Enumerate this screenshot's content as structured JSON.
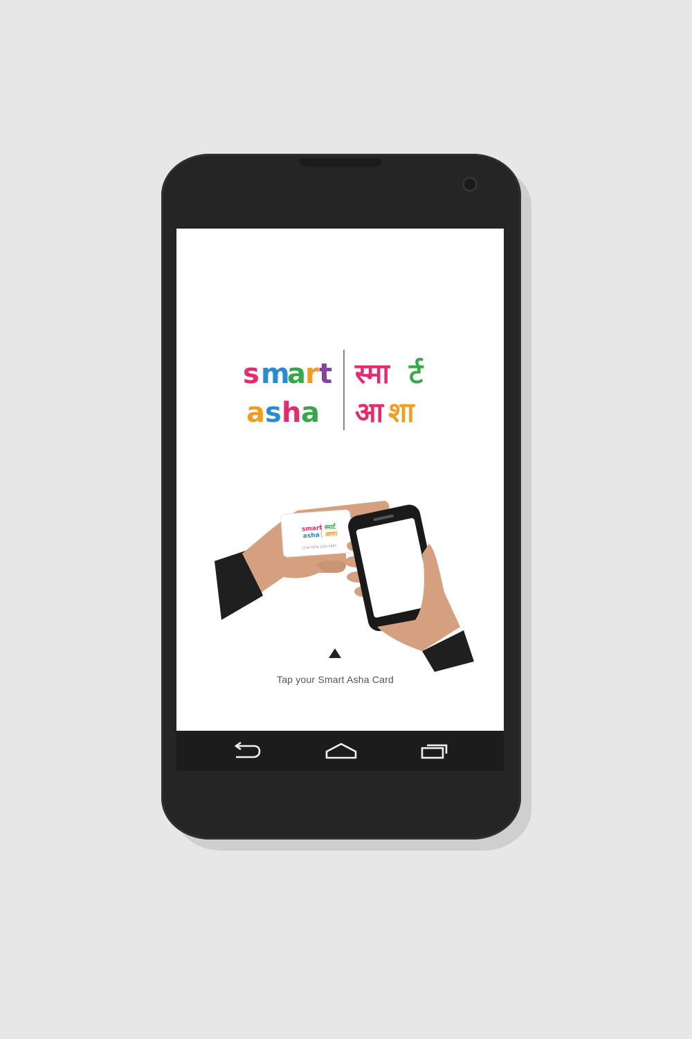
{
  "screen": {
    "logo": {
      "english_text": "smart asha",
      "hindi_text": "स्मार्ट आशा"
    },
    "card": {
      "logo_text": "smart asha | स्मार्ट आशा",
      "number": "1234 5678 1243 5687"
    },
    "hint": {
      "text": "Tap your Smart Asha Card",
      "icon": "triangle-up-icon"
    }
  },
  "navbar": {
    "back_icon": "back-arrow-icon",
    "home_icon": "home-icon",
    "recents_icon": "recent-apps-icon"
  },
  "colors": {
    "background": "#e7e7e7",
    "phone_body": "#252525",
    "screen": "#ffffff",
    "navbar": "#1c1c1c",
    "skin": "#d4a07f",
    "sleeve": "#1f1f1f",
    "logo_pink": "#e8286b",
    "logo_blue": "#2a8bd4",
    "logo_green": "#35a84a",
    "logo_orange": "#f39c1f",
    "logo_purple": "#8a3ea8"
  }
}
